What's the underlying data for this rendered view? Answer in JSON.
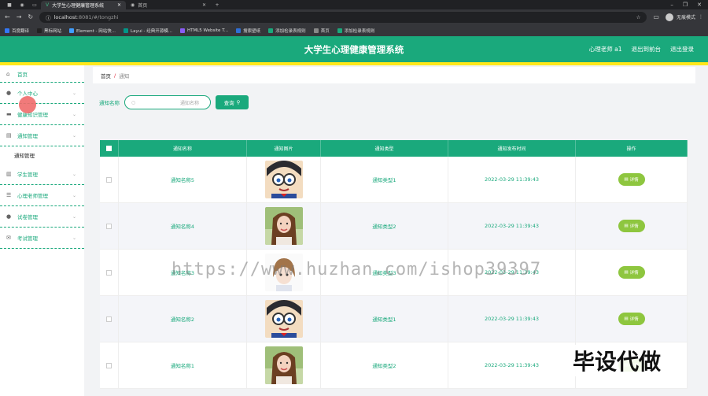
{
  "browser": {
    "tabs": [
      {
        "label": "大学生心理健康管理系统",
        "active": true
      },
      {
        "label": "首页",
        "active": false
      }
    ],
    "url_host": "localhost",
    "url_path": ":8081/#/tongzhi",
    "profile_label": "无痕模式",
    "bookmarks": [
      {
        "label": "百度翻译",
        "color": "#3478f6"
      },
      {
        "label": "黑标网站",
        "color": "#222222"
      },
      {
        "label": "Element - 网站快...",
        "color": "#409eff"
      },
      {
        "label": "Layui - 经典开源模...",
        "color": "#009688"
      },
      {
        "label": "HTML5 Website T...",
        "color": "#8a5cf6"
      },
      {
        "label": "搜索壁纸",
        "color": "#2f6fd6"
      },
      {
        "label": "添加检录表规则",
        "color": "#1aa97c"
      },
      {
        "label": "首页",
        "color": "#888888"
      },
      {
        "label": "添加检录表规则",
        "color": "#1aa97c"
      }
    ]
  },
  "header": {
    "title": "大学生心理健康管理系统",
    "user": "心理老师 a1",
    "back_label": "退出到前台",
    "logout_label": "退出登录"
  },
  "sidebar": {
    "items": [
      {
        "label": "首页",
        "icon": "home-icon",
        "glyph": "⌂"
      },
      {
        "label": "个人中心",
        "icon": "user-icon",
        "glyph": "●"
      },
      {
        "label": "健康知识管理",
        "icon": "monitor-icon",
        "glyph": "▬"
      },
      {
        "label": "通知管理",
        "icon": "document-icon",
        "glyph": "▤"
      },
      {
        "label": "学生管理",
        "icon": "lock-icon",
        "glyph": "▥"
      },
      {
        "label": "心理老师管理",
        "icon": "list-icon",
        "glyph": "☰"
      },
      {
        "label": "试卷管理",
        "icon": "user-icon",
        "glyph": "●"
      },
      {
        "label": "考试管理",
        "icon": "mail-icon",
        "glyph": "✉"
      }
    ],
    "sub_item": "通知管理"
  },
  "breadcrumb": {
    "home": "首页",
    "sep": "/",
    "current": "通知"
  },
  "search": {
    "label": "通知名称",
    "placeholder": "通知名称",
    "button": "查询"
  },
  "table": {
    "headers": [
      "通知名称",
      "通知图片",
      "通知类型",
      "通知发布时间",
      "操作"
    ],
    "edit_label": "详情",
    "rows": [
      {
        "name": "通知名称5",
        "type": "通知类型1",
        "time": "2022-03-29 11:39:43",
        "pic": "conan"
      },
      {
        "name": "通知名称4",
        "type": "通知类型2",
        "time": "2022-03-29 11:39:43",
        "pic": "girl"
      },
      {
        "name": "通知名称3",
        "type": "通知类型3",
        "time": "2022-03-29 11:39:43",
        "pic": "anime"
      },
      {
        "name": "通知名称2",
        "type": "通知类型1",
        "time": "2022-03-29 11:39:43",
        "pic": "conan"
      },
      {
        "name": "通知名称1",
        "type": "通知类型2",
        "time": "2022-03-29 11:39:43",
        "pic": "girl"
      }
    ]
  },
  "watermark": "https://www.huzhan.com/ishop39397",
  "corner_text": "毕设代做"
}
